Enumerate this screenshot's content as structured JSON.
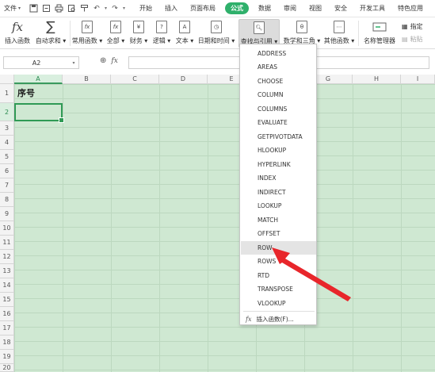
{
  "menubar": {
    "file_label": "文件",
    "menus": [
      "开始",
      "插入",
      "页面布局",
      "公式",
      "数据",
      "审阅",
      "视图",
      "安全",
      "开发工具",
      "特色应用"
    ],
    "active_menu": "公式"
  },
  "ribbon": {
    "insert_function": "插入函数",
    "autosum": "自动求和",
    "common_functions": "常用函数",
    "all": "全部",
    "financial": "财务",
    "logical": "逻辑",
    "text": "文本",
    "datetime": "日期和时间",
    "lookup_reference": "查找与引用",
    "math_trig": "数学和三角",
    "other_functions": "其他函数",
    "name_manager": "名称管理器",
    "define": "指定",
    "paste": "粘贴",
    "accent_color": "#2fb06b"
  },
  "formula_bar": {
    "name_box_value": "A2",
    "fx_label": "fx",
    "formula_value": ""
  },
  "sheet": {
    "columns": [
      "A",
      "B",
      "C",
      "D",
      "E",
      "F",
      "G",
      "H",
      "I"
    ],
    "rows": [
      "1",
      "2",
      "3",
      "4",
      "5",
      "6",
      "7",
      "8",
      "9",
      "10",
      "11",
      "12",
      "13",
      "14",
      "15",
      "16",
      "17",
      "18",
      "19",
      "20"
    ],
    "cell_a1": "序号",
    "selected_cell": "A2",
    "background_color": "#cfe8d2"
  },
  "dropdown": {
    "items": [
      "ADDRESS",
      "AREAS",
      "CHOOSE",
      "COLUMN",
      "COLUMNS",
      "EVALUATE",
      "GETPIVOTDATA",
      "HLOOKUP",
      "HYPERLINK",
      "INDEX",
      "INDIRECT",
      "LOOKUP",
      "MATCH",
      "OFFSET",
      "ROW",
      "ROWS",
      "RTD",
      "TRANSPOSE",
      "VLOOKUP"
    ],
    "highlighted": "ROW",
    "insert_function_label": "插入函数(F)..."
  },
  "annotation": {
    "arrow_color": "#e8262b"
  }
}
